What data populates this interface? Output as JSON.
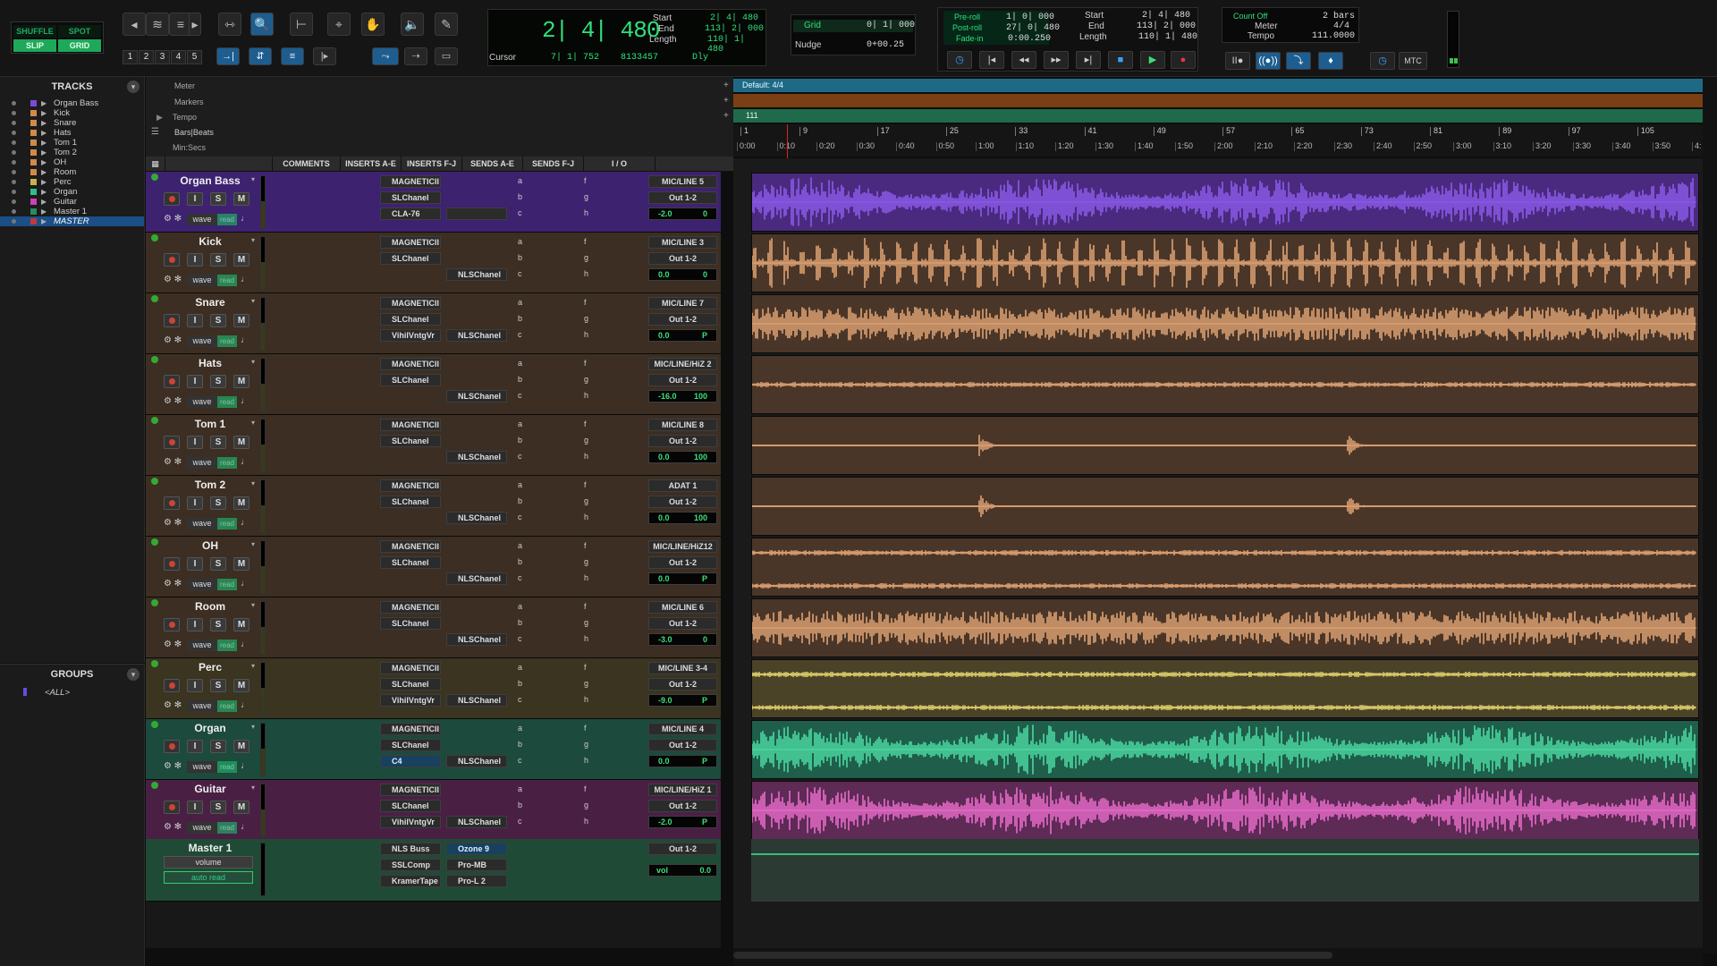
{
  "modes": {
    "shuffle": "SHUFFLE",
    "spot": "SPOT",
    "slip": "SLIP",
    "grid": "GRID"
  },
  "zoom_presets": [
    "1",
    "2",
    "3",
    "4",
    "5"
  ],
  "counter": {
    "main": "2| 4| 480",
    "start_label": "Start",
    "start": "2| 4| 480",
    "end_label": "End",
    "end": "113| 2| 000",
    "length_label": "Length",
    "length": "110| 1| 480",
    "cursor_label": "Cursor",
    "cursor": "7| 1| 752",
    "sample": "8133457",
    "dly": "Dly"
  },
  "grid": {
    "label": "Grid",
    "value": "0| 1| 000",
    "nudge_label": "Nudge",
    "nudge_value": "0+00.25"
  },
  "transport": {
    "preroll_label": "Pre-roll",
    "preroll": "1| 0| 000",
    "postroll_label": "Post-roll",
    "postroll": "27| 0| 480",
    "fadein_label": "Fade-in",
    "fadein": "0:00.250",
    "start_label": "Start",
    "start": "2| 4| 480",
    "end_label": "End",
    "end": "113| 2| 000",
    "length_label": "Length",
    "length": "110| 1| 480"
  },
  "meter_panel": {
    "countoff_label": "Count Off",
    "countoff": "2 bars",
    "meter_label": "Meter",
    "meter": "4/4",
    "tempo_label": "Tempo",
    "tempo": "111.0000",
    "mtc": "MTC"
  },
  "tracks_panel": {
    "title": "TRACKS",
    "items": [
      {
        "name": "Organ Bass",
        "color": "#7a4bd8"
      },
      {
        "name": "Kick",
        "color": "#d08a4a"
      },
      {
        "name": "Snare",
        "color": "#d08a4a"
      },
      {
        "name": "Hats",
        "color": "#d08a4a"
      },
      {
        "name": "Tom 1",
        "color": "#d08a4a"
      },
      {
        "name": "Tom 2",
        "color": "#d08a4a"
      },
      {
        "name": "OH",
        "color": "#d08a4a"
      },
      {
        "name": "Room",
        "color": "#d08a4a"
      },
      {
        "name": "Perc",
        "color": "#c8b34a"
      },
      {
        "name": "Organ",
        "color": "#2dbf8a"
      },
      {
        "name": "Guitar",
        "color": "#d040b0"
      },
      {
        "name": "Master 1",
        "color": "#2a8a5a"
      },
      {
        "name": "MASTER",
        "color": "#c03a3a"
      }
    ]
  },
  "groups_panel": {
    "title": "GROUPS",
    "all": "<ALL>"
  },
  "rulers": {
    "meter": "Meter",
    "markers": "Markers",
    "tempo": "Tempo",
    "bars": "Bars|Beats",
    "minsecs": "Min:Secs",
    "meter_event": "Default: 4/4",
    "tempo_event": "111"
  },
  "bar_ticks": [
    "1",
    "9",
    "17",
    "25",
    "33",
    "41",
    "49",
    "57",
    "65",
    "73",
    "81",
    "89",
    "97",
    "105"
  ],
  "time_ticks": [
    "0:00",
    "0:10",
    "0:20",
    "0:30",
    "0:40",
    "0:50",
    "1:00",
    "1:10",
    "1:20",
    "1:30",
    "1:40",
    "1:50",
    "2:00",
    "2:10",
    "2:20",
    "2:30",
    "2:40",
    "2:50",
    "3:00",
    "3:10",
    "3:20",
    "3:30",
    "3:40",
    "3:50",
    "4:"
  ],
  "columns": {
    "comments": "COMMENTS",
    "inserts_ae": "INSERTS A-E",
    "inserts_fj": "INSERTS F-J",
    "sends_ae": "SENDS A-E",
    "sends_fj": "SENDS F-J",
    "io": "I / O"
  },
  "sends_ae": [
    "a",
    "b",
    "c"
  ],
  "sends_fj": [
    "f",
    "g",
    "h"
  ],
  "labels": {
    "wave": "wave",
    "read": "read",
    "rec": "",
    "input": "I",
    "solo": "S",
    "mute": "M"
  },
  "track_list": [
    {
      "name": "Organ Bass",
      "ins1": "MAGNETICII",
      "ins2": "SLChanel",
      "ins3": "CLA-76",
      "insF1": "",
      "insF3": "",
      "in": "MIC/LINE 5",
      "out": "Out 1-2",
      "vol": "-2.0",
      "pan": "0",
      "bg": "#3d2270",
      "wave": "#8f5cf0",
      "lanebg": "#4a2a7e"
    },
    {
      "name": "Kick",
      "ins1": "MAGNETICII",
      "ins2": "SLChanel",
      "ins3": "",
      "insF1": "",
      "insF3": "NLSChanel",
      "in": "MIC/LINE 3",
      "out": "Out 1-2",
      "vol": "0.0",
      "pan": "0",
      "bg": "#3c2e22",
      "wave": "#e8a878",
      "lanebg": "#4a3628"
    },
    {
      "name": "Snare",
      "ins1": "MAGNETICII",
      "ins2": "SLChanel",
      "ins3": "VihilVntgVr",
      "insF1": "",
      "insF3": "NLSChanel",
      "in": "MIC/LINE 7",
      "out": "Out 1-2",
      "vol": "0.0",
      "pan": "P",
      "bg": "#3c2e22",
      "wave": "#e8a878",
      "lanebg": "#4a3628"
    },
    {
      "name": "Hats",
      "ins1": "MAGNETICII",
      "ins2": "SLChanel",
      "ins3": "",
      "insF1": "",
      "insF3": "NLSChanel",
      "in": "MIC/LINE/HiZ 2",
      "out": "Out 1-2",
      "vol": "-16.0",
      "pan": "100",
      "bg": "#3c2e22",
      "wave": "#e8a878",
      "lanebg": "#4a3628"
    },
    {
      "name": "Tom 1",
      "ins1": "MAGNETICII",
      "ins2": "SLChanel",
      "ins3": "",
      "insF1": "",
      "insF3": "NLSChanel",
      "in": "MIC/LINE 8",
      "out": "Out 1-2",
      "vol": "0.0",
      "pan": "100",
      "bg": "#3c2e22",
      "wave": "#e8a878",
      "lanebg": "#4a3628"
    },
    {
      "name": "Tom 2",
      "ins1": "MAGNETICII",
      "ins2": "SLChanel",
      "ins3": "",
      "insF1": "",
      "insF3": "NLSChanel",
      "in": "ADAT 1",
      "out": "Out 1-2",
      "vol": "0.0",
      "pan": "100",
      "bg": "#3c2e22",
      "wave": "#e8a878",
      "lanebg": "#4a3628"
    },
    {
      "name": "OH",
      "ins1": "MAGNETICII",
      "ins2": "SLChanel",
      "ins3": "",
      "insF1": "",
      "insF3": "NLSChanel",
      "in": "MIC/LINE/HiZ12",
      "out": "Out 1-2",
      "vol": "0.0",
      "pan": "P",
      "bg": "#3c2e22",
      "wave": "#e8a878",
      "lanebg": "#4a3628"
    },
    {
      "name": "Room",
      "ins1": "MAGNETICII",
      "ins2": "SLChanel",
      "ins3": "",
      "insF1": "",
      "insF3": "NLSChanel",
      "in": "MIC/LINE 6",
      "out": "Out 1-2",
      "vol": "-3.0",
      "pan": "0",
      "bg": "#3c2e22",
      "wave": "#e8a878",
      "lanebg": "#4a3628"
    },
    {
      "name": "Perc",
      "ins1": "MAGNETICII",
      "ins2": "SLChanel",
      "ins3": "VihilVntgVr",
      "insF1": "",
      "insF3": "NLSChanel",
      "in": "MIC/LINE 3-4",
      "out": "Out 1-2",
      "vol": "-9.0",
      "pan": "P",
      "bg": "#3a3420",
      "wave": "#e8d870",
      "lanebg": "#4a4328"
    },
    {
      "name": "Organ",
      "ins1": "MAGNETICII",
      "ins2": "SLChanel",
      "ins3": "C4",
      "insF1": "",
      "insF3": "NLSChanel",
      "in": "MIC/LINE 4",
      "out": "Out 1-2",
      "vol": "0.0",
      "pan": "P",
      "bg": "#1c4a3c",
      "wave": "#4ee0a8",
      "lanebg": "#1f5e4a"
    },
    {
      "name": "Guitar",
      "ins1": "MAGNETICII",
      "ins2": "SLChanel",
      "ins3": "VihilVntgVr",
      "insF1": "",
      "insF3": "NLSChanel",
      "in": "MIC/LINE/HiZ 1",
      "out": "Out 1-2",
      "vol": "-2.0",
      "pan": "P",
      "bg": "#4a1f44",
      "wave": "#f070d0",
      "lanebg": "#5e2a56"
    }
  ],
  "master": {
    "name": "Master 1",
    "view": "volume",
    "auto": "auto read",
    "ins1": "NLS Buss",
    "ins2": "SSLComp",
    "ins3": "KramerTape",
    "insF1": "Ozone 9",
    "insF2": "Pro-MB",
    "insF3": "Pro-L 2",
    "out": "Out 1-2",
    "vol_label": "vol",
    "vol": "0.0"
  }
}
